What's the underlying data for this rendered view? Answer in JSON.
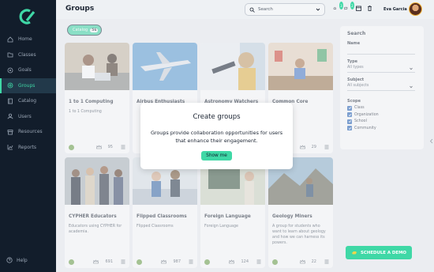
{
  "header": {
    "title": "Groups",
    "search_label": "Search",
    "user_name": "Eva Garcia",
    "badges": [
      "3",
      "2"
    ]
  },
  "sidebar": {
    "items": [
      {
        "label": "Home",
        "icon": "home-icon"
      },
      {
        "label": "Classes",
        "icon": "folder-icon"
      },
      {
        "label": "Goals",
        "icon": "target-icon"
      },
      {
        "label": "Groups",
        "icon": "group-icon",
        "active": true
      },
      {
        "label": "Catalog",
        "icon": "book-icon"
      },
      {
        "label": "Users",
        "icon": "user-icon"
      },
      {
        "label": "Resources",
        "icon": "archive-icon"
      },
      {
        "label": "Reports",
        "icon": "chart-icon"
      }
    ],
    "help": "Help"
  },
  "filter_pill": {
    "label": "Catalog",
    "count": "56"
  },
  "cards": [
    {
      "title": "1 to 1 Computing",
      "desc": "1 to 1 Computing",
      "count": "95"
    },
    {
      "title": "Airbus Enthusiasts",
      "desc": "",
      "count": ""
    },
    {
      "title": "Astronomy Watchers",
      "desc": "",
      "count": ""
    },
    {
      "title": "Common Core",
      "desc": "",
      "count": "29"
    },
    {
      "title": "CYPHER Educators",
      "desc": "Educators using CYPHER for academia.",
      "count": "691"
    },
    {
      "title": "Flipped Classrooms",
      "desc": "Flipped Classrooms",
      "count": "987"
    },
    {
      "title": "Foreign Language",
      "desc": "Foreign Language",
      "count": "124"
    },
    {
      "title": "Geology Miners",
      "desc": "A group for students who want to learn about geology and how we can harness its powers.",
      "count": "22"
    }
  ],
  "filters": {
    "heading": "Search",
    "name_label": "Name",
    "type_label": "Type",
    "type_value": "All types",
    "subject_label": "Subject",
    "subject_value": "All subjects",
    "scope_label": "Scope",
    "scope_options": [
      "Class",
      "Organization",
      "School",
      "Community"
    ]
  },
  "modal": {
    "title": "Create groups",
    "body": "Groups provide collaboration opportunities for users that enhance their engagement.",
    "button": "Show me"
  },
  "demo_button": "SCHEDULE A DEMO",
  "colors": {
    "accent": "#3fd8a6",
    "sidebar": "#121d2b",
    "checkbox": "#2563b8"
  }
}
